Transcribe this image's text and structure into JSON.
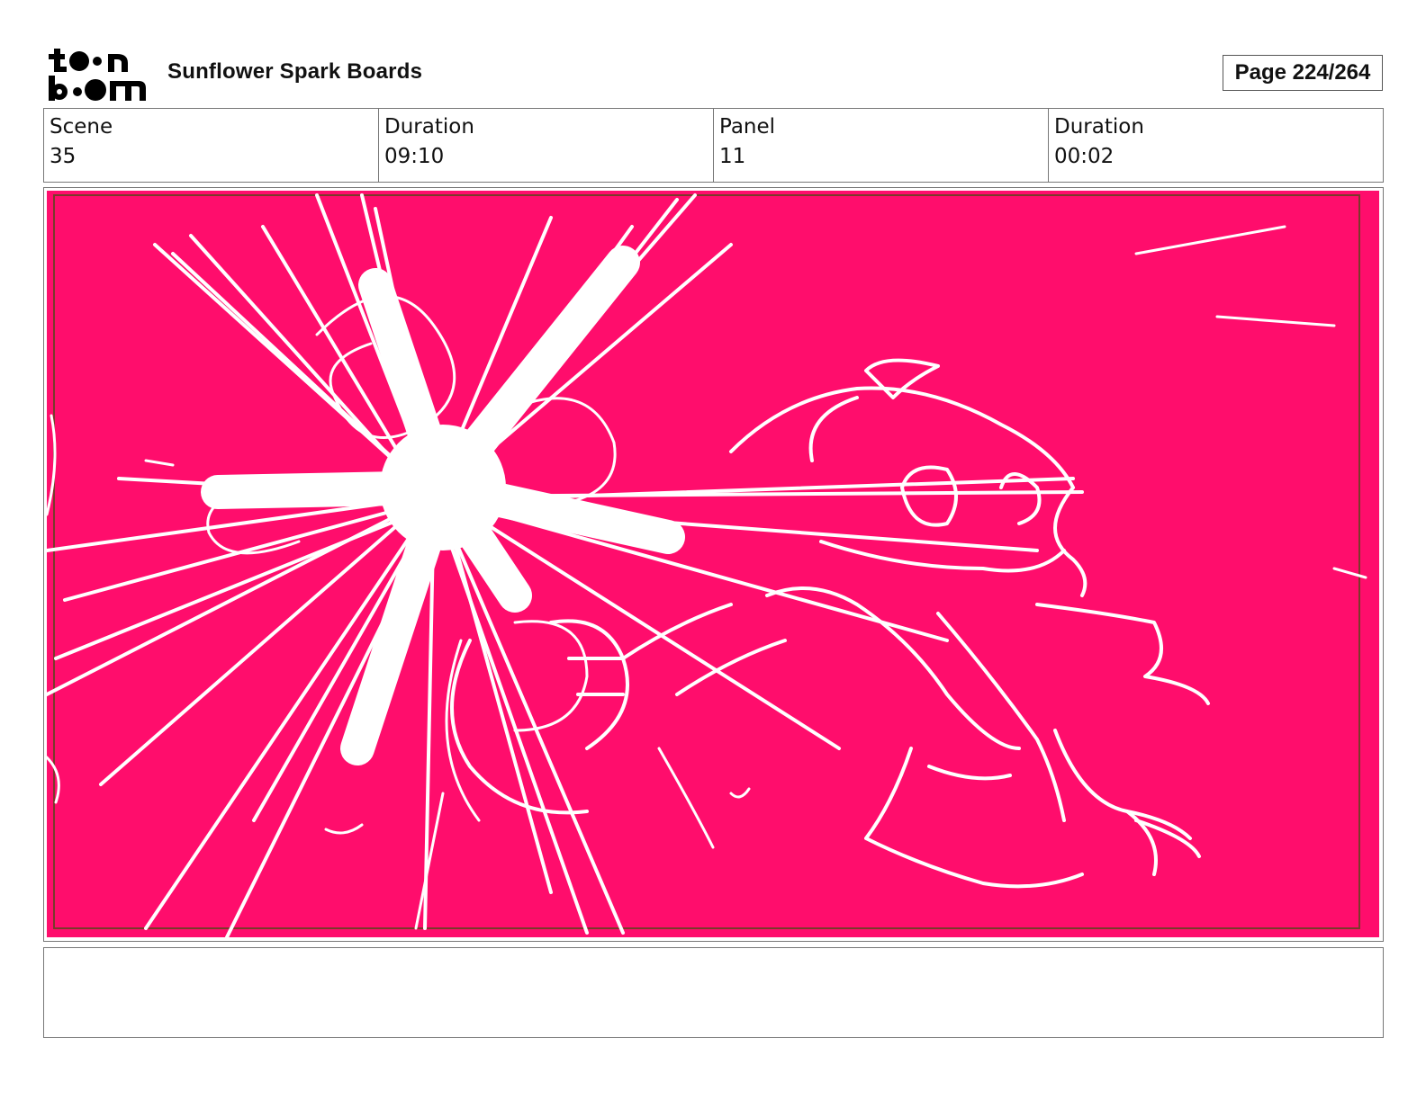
{
  "header": {
    "logo_text": "toon boom",
    "project_title": "Sunflower Spark Boards",
    "page_label": "Page 224/264"
  },
  "info": [
    {
      "label": "Scene",
      "value": "35"
    },
    {
      "label": "Duration",
      "value": "09:10"
    },
    {
      "label": "Panel",
      "value": "11"
    },
    {
      "label": "Duration",
      "value": "00:02"
    }
  ],
  "panel": {
    "background_color": "#ff0d6c",
    "stroke_color": "#ffffff",
    "frame_color": "#7a3a2a"
  },
  "notes": {
    "text": ""
  }
}
